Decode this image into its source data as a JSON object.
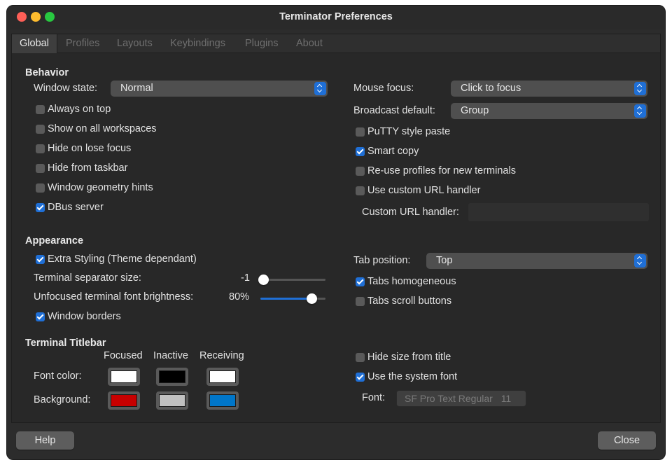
{
  "window": {
    "title": "Terminator Preferences"
  },
  "tabs": [
    "Global",
    "Profiles",
    "Layouts",
    "Keybindings",
    "Plugins",
    "About"
  ],
  "behavior": {
    "heading": "Behavior",
    "window_state_label": "Window state:",
    "window_state_value": "Normal",
    "always_on_top": {
      "label": "Always on top",
      "checked": false
    },
    "show_on_all_workspaces": {
      "label": "Show on all workspaces",
      "checked": false
    },
    "hide_on_lose_focus": {
      "label": "Hide on lose focus",
      "checked": false
    },
    "hide_from_taskbar": {
      "label": "Hide from taskbar",
      "checked": false
    },
    "window_geometry_hints": {
      "label": "Window geometry hints",
      "checked": false
    },
    "dbus_server": {
      "label": "DBus server",
      "checked": true
    },
    "mouse_focus_label": "Mouse focus:",
    "mouse_focus_value": "Click to focus",
    "broadcast_default_label": "Broadcast default:",
    "broadcast_default_value": "Group",
    "putty_style_paste": {
      "label": "PuTTY style paste",
      "checked": false
    },
    "smart_copy": {
      "label": "Smart copy",
      "checked": true
    },
    "reuse_profiles": {
      "label": "Re-use profiles for new terminals",
      "checked": false
    },
    "use_custom_url_handler": {
      "label": "Use custom URL handler",
      "checked": false
    },
    "custom_url_handler_label": "Custom URL handler:",
    "custom_url_handler_value": ""
  },
  "appearance": {
    "heading": "Appearance",
    "extra_styling": {
      "label": "Extra Styling (Theme dependant)",
      "checked": true
    },
    "separator_size_label": "Terminal separator size:",
    "separator_size_value": "-1",
    "separator_size_fraction": 0.0,
    "unfocused_brightness_label": "Unfocused terminal font brightness:",
    "unfocused_brightness_value": "80%",
    "unfocused_brightness_fraction": 0.8,
    "window_borders": {
      "label": "Window borders",
      "checked": true
    },
    "tab_position_label": "Tab position:",
    "tab_position_value": "Top",
    "tabs_homogeneous": {
      "label": "Tabs homogeneous",
      "checked": true
    },
    "tabs_scroll_buttons": {
      "label": "Tabs scroll buttons",
      "checked": false
    }
  },
  "titlebar": {
    "heading": "Terminal Titlebar",
    "col_focused": "Focused",
    "col_inactive": "Inactive",
    "col_receiving": "Receiving",
    "font_color_label": "Font color:",
    "background_label": "Background:",
    "font_colors": {
      "focused": "#ffffff",
      "inactive": "#000000",
      "receiving": "#ffffff"
    },
    "background_colors": {
      "focused": "#c80000",
      "inactive": "#c0c0c0",
      "receiving": "#0076c9"
    },
    "hide_size_from_title": {
      "label": "Hide size from title",
      "checked": false
    },
    "use_system_font": {
      "label": "Use the system font",
      "checked": true
    },
    "font_label": "Font:",
    "font_name": "SF Pro Text Regular",
    "font_size": "11"
  },
  "buttons": {
    "help": "Help",
    "close": "Close"
  },
  "colors": {
    "accent": "#1f6fd6",
    "window_bg": "#2c2c2c",
    "panel_bg": "#282828"
  }
}
